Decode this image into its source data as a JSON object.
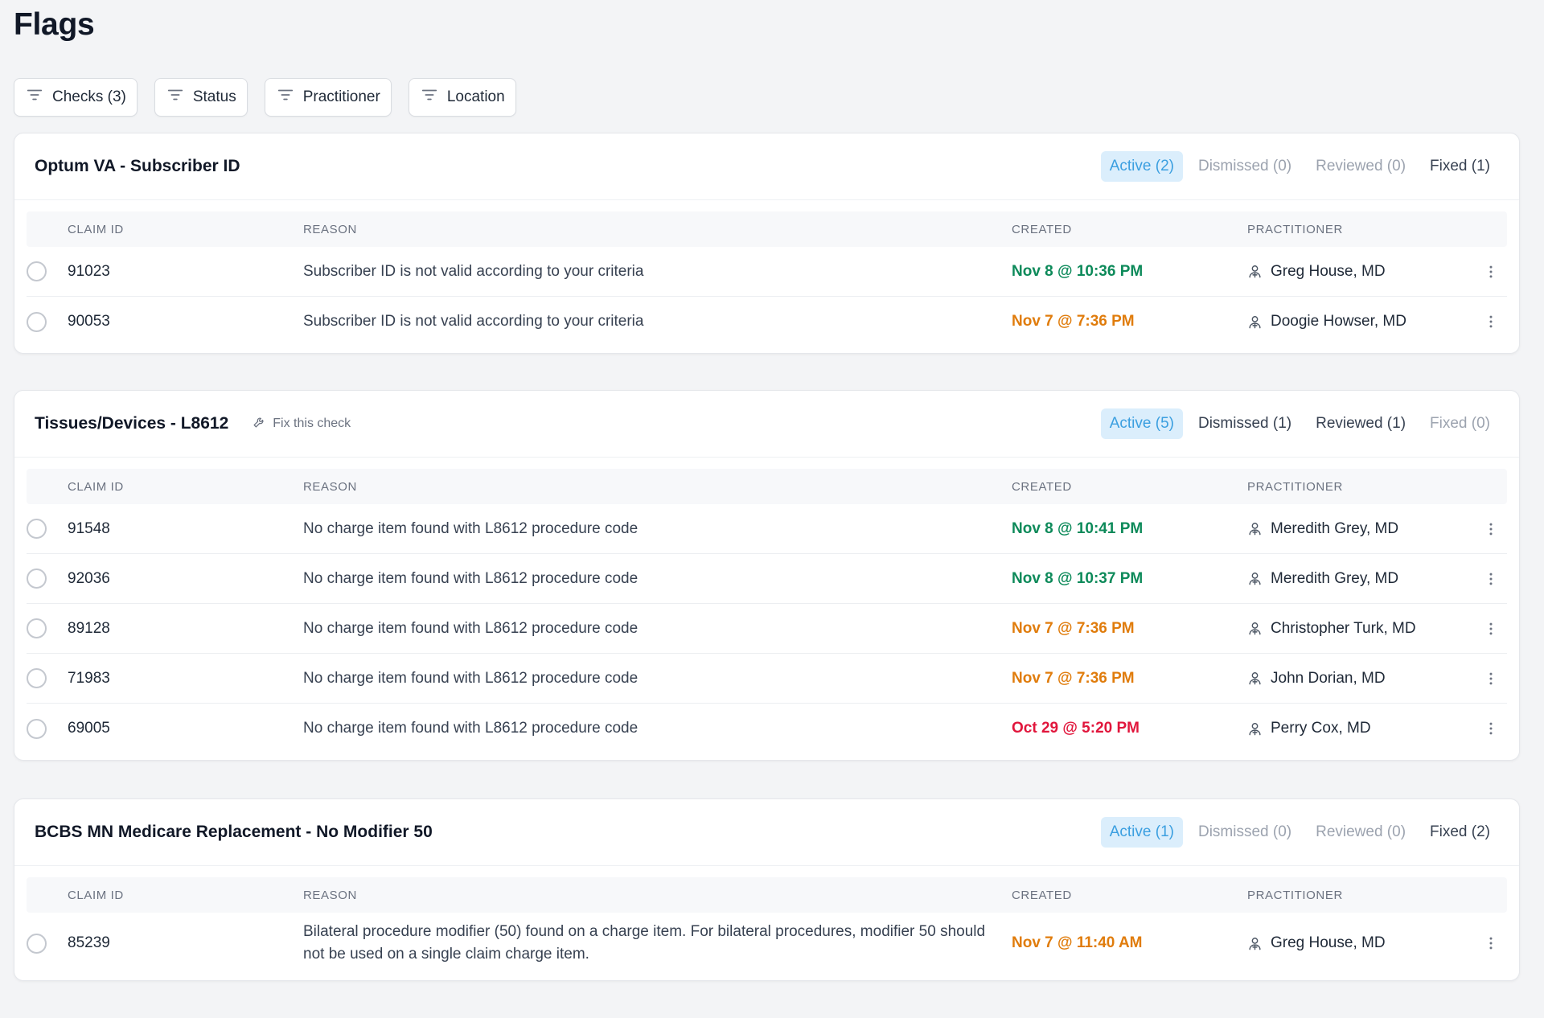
{
  "page": {
    "title": "Flags"
  },
  "filters": [
    {
      "label": "Checks (3)"
    },
    {
      "label": "Status"
    },
    {
      "label": "Practitioner"
    },
    {
      "label": "Location"
    }
  ],
  "colors": {
    "green": "#0d8a5a",
    "orange": "#e07c0c",
    "red": "#e1163c",
    "active_tab": "#3b9fe0"
  },
  "columns": {
    "claim_id": "CLAIM ID",
    "reason": "REASON",
    "created": "CREATED",
    "practitioner": "PRACTITIONER"
  },
  "sections": [
    {
      "title": "Optum VA - Subscriber ID",
      "fix_link": "",
      "tabs": [
        "Active (2)",
        "Dismissed (0)",
        "Reviewed (0)",
        "Fixed (1)"
      ],
      "rows": [
        {
          "claim_id": "91023",
          "reason": "Subscriber ID is not valid according to your criteria",
          "created": "Nov 8 @ 10:36 PM",
          "status_color": "green",
          "practitioner": "Greg House, MD"
        },
        {
          "claim_id": "90053",
          "reason": "Subscriber ID is not valid according to your criteria",
          "created": "Nov 7 @ 7:36 PM",
          "status_color": "orange",
          "practitioner": "Doogie Howser, MD"
        }
      ]
    },
    {
      "title": "Tissues/Devices - L8612",
      "fix_link": "Fix this check",
      "tabs": [
        "Active (5)",
        "Dismissed (1)",
        "Reviewed (1)",
        "Fixed (0)"
      ],
      "rows": [
        {
          "claim_id": "91548",
          "reason": "No charge item found with L8612 procedure code",
          "created": "Nov 8 @ 10:41 PM",
          "status_color": "green",
          "practitioner": "Meredith Grey, MD"
        },
        {
          "claim_id": "92036",
          "reason": "No charge item found with L8612 procedure code",
          "created": "Nov 8 @ 10:37 PM",
          "status_color": "green",
          "practitioner": "Meredith Grey, MD"
        },
        {
          "claim_id": "89128",
          "reason": "No charge item found with L8612 procedure code",
          "created": "Nov 7 @ 7:36 PM",
          "status_color": "orange",
          "practitioner": "Christopher Turk, MD"
        },
        {
          "claim_id": "71983",
          "reason": "No charge item found with L8612 procedure code",
          "created": "Nov 7 @ 7:36 PM",
          "status_color": "orange",
          "practitioner": "John Dorian, MD"
        },
        {
          "claim_id": "69005",
          "reason": "No charge item found with L8612 procedure code",
          "created": "Oct 29 @ 5:20 PM",
          "status_color": "red",
          "practitioner": "Perry Cox, MD"
        }
      ]
    },
    {
      "title": "BCBS MN Medicare Replacement - No Modifier 50",
      "fix_link": "",
      "tabs": [
        "Active (1)",
        "Dismissed (0)",
        "Reviewed (0)",
        "Fixed (2)"
      ],
      "rows": [
        {
          "claim_id": "85239",
          "reason": "Bilateral procedure modifier (50) found on a charge item. For bilateral procedures, modifier 50 should not be used on a single claim charge item.",
          "created": "Nov 7 @ 11:40 AM",
          "status_color": "orange",
          "practitioner": "Greg House, MD"
        }
      ]
    }
  ]
}
